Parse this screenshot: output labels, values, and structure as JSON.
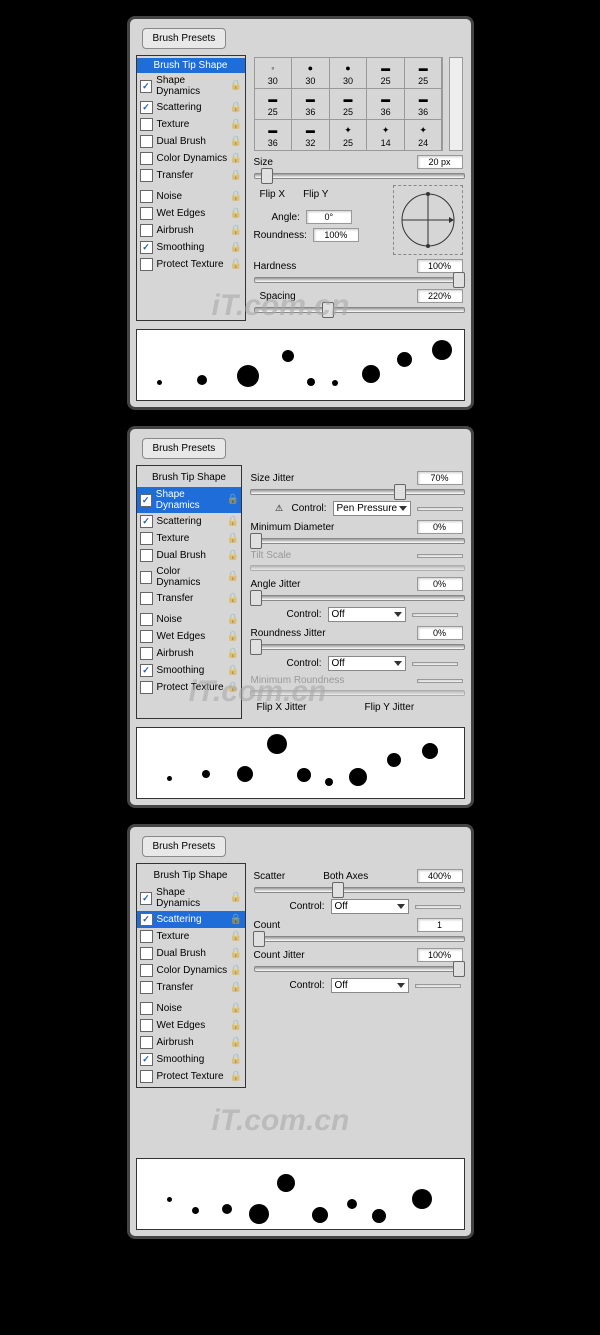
{
  "p1": {
    "presets": "Brush Presets",
    "sidebar": [
      "Brush Tip Shape",
      "Shape Dynamics",
      "Scattering",
      "Texture",
      "Dual Brush",
      "Color Dynamics",
      "Transfer",
      "Noise",
      "Wet Edges",
      "Airbrush",
      "Smoothing",
      "Protect Texture"
    ],
    "checks": [
      null,
      true,
      true,
      false,
      false,
      false,
      false,
      false,
      false,
      false,
      true,
      false
    ],
    "sel": 0,
    "thumbs": [
      "30",
      "30",
      "30",
      "25",
      "25",
      "25",
      "36",
      "25",
      "36",
      "36",
      "36",
      "32",
      "25",
      "14",
      "24"
    ],
    "size_lbl": "Size",
    "size_val": "20 px",
    "flipx": "Flip X",
    "flipy": "Flip Y",
    "angle_lbl": "Angle:",
    "angle_val": "0°",
    "round_lbl": "Roundness:",
    "round_val": "100%",
    "hard_lbl": "Hardness",
    "hard_val": "100%",
    "space_lbl": "Spacing",
    "space_val": "220%",
    "space_on": true
  },
  "p2": {
    "presets": "Brush Presets",
    "sidebar": [
      "Brush Tip Shape",
      "Shape Dynamics",
      "Scattering",
      "Texture",
      "Dual Brush",
      "Color Dynamics",
      "Transfer",
      "Noise",
      "Wet Edges",
      "Airbrush",
      "Smoothing",
      "Protect Texture"
    ],
    "checks": [
      null,
      true,
      true,
      false,
      false,
      false,
      false,
      false,
      false,
      false,
      true,
      false
    ],
    "sel": 1,
    "sj_lbl": "Size Jitter",
    "sj_val": "70%",
    "ctrl_lbl": "Control:",
    "ctrl1": "Pen Pressure",
    "md_lbl": "Minimum Diameter",
    "md_val": "0%",
    "ts_lbl": "Tilt Scale",
    "aj_lbl": "Angle Jitter",
    "aj_val": "0%",
    "ctrl2": "Off",
    "rj_lbl": "Roundness Jitter",
    "rj_val": "0%",
    "ctrl3": "Off",
    "mr_lbl": "Minimum Roundness",
    "fxj": "Flip X Jitter",
    "fyj": "Flip Y Jitter"
  },
  "p3": {
    "presets": "Brush Presets",
    "sidebar": [
      "Brush Tip Shape",
      "Shape Dynamics",
      "Scattering",
      "Texture",
      "Dual Brush",
      "Color Dynamics",
      "Transfer",
      "Noise",
      "Wet Edges",
      "Airbrush",
      "Smoothing",
      "Protect Texture"
    ],
    "checks": [
      null,
      true,
      true,
      false,
      false,
      false,
      false,
      false,
      false,
      false,
      true,
      false
    ],
    "sel": 2,
    "sc_lbl": "Scatter",
    "ba_lbl": "Both Axes",
    "sc_val": "400%",
    "ctrl_lbl": "Control:",
    "ctrl1": "Off",
    "cnt_lbl": "Count",
    "cnt_val": "1",
    "cj_lbl": "Count Jitter",
    "cj_val": "100%",
    "ctrl2": "Off"
  },
  "watermark": "iT.com.cn"
}
